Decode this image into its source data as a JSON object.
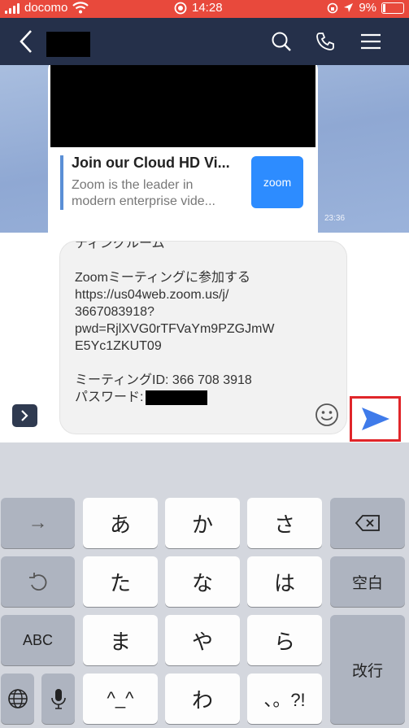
{
  "status_bar": {
    "carrier": "docomo",
    "time": "14:28",
    "battery": "9%"
  },
  "header": {
    "back_icon": "chevron-left-icon",
    "icons": [
      "search-icon",
      "phone-icon",
      "menu-icon"
    ]
  },
  "link_card": {
    "title": "Join our Cloud HD Vi...",
    "description_lines": [
      "Zoom is the leader in",
      "modern enterprise vide..."
    ],
    "logo_text": "zoom",
    "timestamp": "23:36"
  },
  "message_input": {
    "lines": [
      "ティングルーム",
      "",
      "Zoomミーティングに参加する",
      "https://us04web.zoom.us/j/",
      "3667083918?",
      "pwd=RjlXVG0rTFVaYm9PZGJmW",
      "E5Yc1ZKUT09",
      "",
      "ミーティングID: 366 708 3918"
    ],
    "password_label": "パスワード:"
  },
  "keyboard": {
    "row1": {
      "left": "→",
      "k1": "あ",
      "k2": "か",
      "k3": "さ"
    },
    "row2": {
      "k1": "た",
      "k2": "な",
      "k3": "は",
      "right": "空白"
    },
    "row3": {
      "left": "ABC",
      "k1": "ま",
      "k2": "や",
      "k3": "ら",
      "right": "改行"
    },
    "row4": {
      "k1": "^_^",
      "k2": "わ",
      "k3": "、。?!"
    }
  },
  "colors": {
    "status_bar": "#e8493c",
    "header": "#25304a",
    "send": "#3f7bea",
    "highlight": "#e0262a"
  }
}
